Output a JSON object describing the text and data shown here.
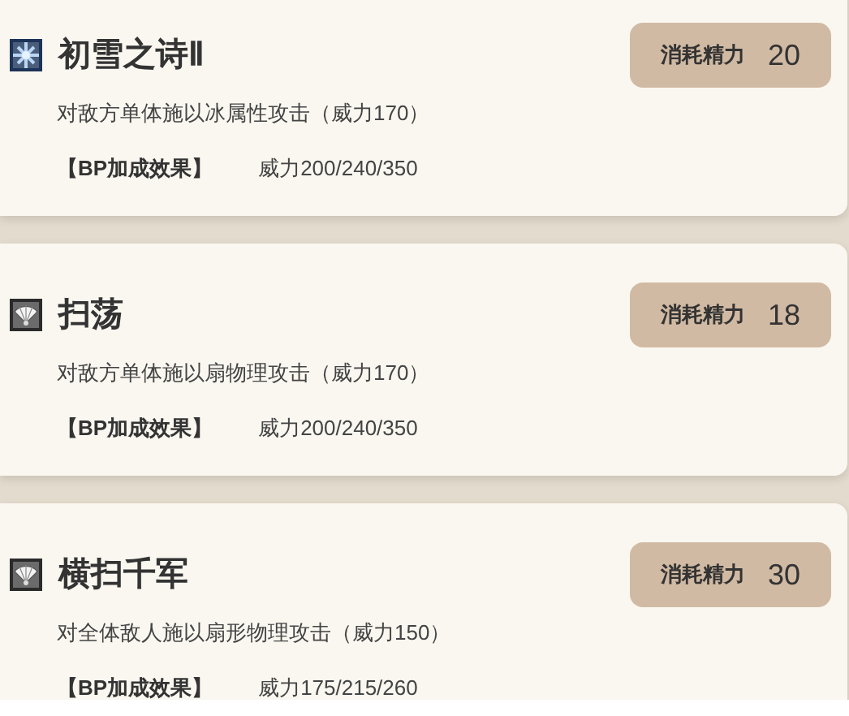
{
  "skills": [
    {
      "kind": "ice",
      "name": "初雪之诗Ⅱ",
      "cost_label": "消耗精力",
      "cost": "20",
      "description": "对敌方单体施以冰属性攻击（威力170）",
      "bp_label": "【BP加成效果】",
      "bp_value": "威力200/240/350"
    },
    {
      "kind": "fan",
      "name": "扫荡",
      "cost_label": "消耗精力",
      "cost": "18",
      "description": "对敌方单体施以扇物理攻击（威力170）",
      "bp_label": "【BP加成效果】",
      "bp_value": "威力200/240/350"
    },
    {
      "kind": "fan",
      "name": "横扫千军",
      "cost_label": "消耗精力",
      "cost": "30",
      "description": "对全体敌人施以扇形物理攻击（威力150）",
      "bp_label": "【BP加成效果】",
      "bp_value": "威力175/215/260"
    }
  ]
}
